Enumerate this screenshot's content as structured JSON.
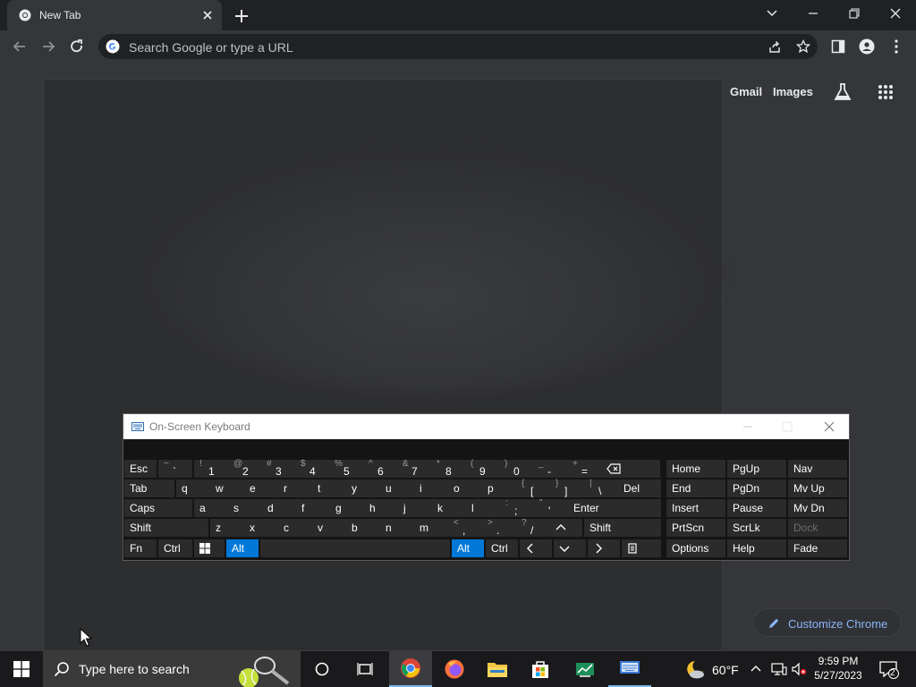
{
  "browser": {
    "tab_title": "New Tab",
    "omnibox_placeholder": "Search Google or type a URL"
  },
  "ntp": {
    "links": [
      "Gmail",
      "Images"
    ],
    "customize_label": "Customize Chrome"
  },
  "osk": {
    "title": "On-Screen Keyboard",
    "rows": [
      [
        {
          "m": "Esc"
        },
        {
          "s": "~",
          "b": "`"
        },
        {
          "s": "!",
          "b": "1"
        },
        {
          "s": "@",
          "b": "2"
        },
        {
          "s": "#",
          "b": "3"
        },
        {
          "s": "$",
          "b": "4"
        },
        {
          "s": "%",
          "b": "5"
        },
        {
          "s": "^",
          "b": "6"
        },
        {
          "s": "&",
          "b": "7"
        },
        {
          "s": "*",
          "b": "8"
        },
        {
          "s": "(",
          "b": "9"
        },
        {
          "s": ")",
          "b": "0"
        },
        {
          "s": "_",
          "b": "-"
        },
        {
          "s": "+",
          "b": "="
        },
        {
          "m": "⌫"
        },
        {
          "m": "Home"
        },
        {
          "m": "PgUp"
        },
        {
          "m": "Nav"
        }
      ],
      [
        {
          "m": "Tab"
        },
        {
          "m": "q"
        },
        {
          "m": "w"
        },
        {
          "m": "e"
        },
        {
          "m": "r"
        },
        {
          "m": "t"
        },
        {
          "m": "y"
        },
        {
          "m": "u"
        },
        {
          "m": "i"
        },
        {
          "m": "o"
        },
        {
          "m": "p"
        },
        {
          "s": "{",
          "b": "["
        },
        {
          "s": "}",
          "b": "]"
        },
        {
          "s": "|",
          "b": "\\"
        },
        {
          "m": "Del"
        },
        {
          "m": "End"
        },
        {
          "m": "PgDn"
        },
        {
          "m": "Mv Up"
        }
      ],
      [
        {
          "m": "Caps"
        },
        {
          "m": "a"
        },
        {
          "m": "s"
        },
        {
          "m": "d"
        },
        {
          "m": "f"
        },
        {
          "m": "g"
        },
        {
          "m": "h"
        },
        {
          "m": "j"
        },
        {
          "m": "k"
        },
        {
          "m": "l"
        },
        {
          "s": ":",
          "b": ";"
        },
        {
          "s": "\"",
          "b": "'"
        },
        {
          "m": "Enter"
        },
        {
          "m": "Insert"
        },
        {
          "m": "Pause"
        },
        {
          "m": "Mv Dn"
        }
      ],
      [
        {
          "m": "Shift"
        },
        {
          "m": "z"
        },
        {
          "m": "x"
        },
        {
          "m": "c"
        },
        {
          "m": "v"
        },
        {
          "m": "b"
        },
        {
          "m": "n"
        },
        {
          "m": "m"
        },
        {
          "s": "<",
          "b": ","
        },
        {
          "s": ">",
          "b": "."
        },
        {
          "s": "?",
          "b": "/"
        },
        {
          "m": "^"
        },
        {
          "m": "Shift"
        },
        {
          "m": "PrtScn"
        },
        {
          "m": "ScrLk"
        },
        {
          "m": "Dock"
        }
      ],
      [
        {
          "m": "Fn"
        },
        {
          "m": "Ctrl"
        },
        {
          "m": "win"
        },
        {
          "m": "Alt"
        },
        {
          "m": ""
        },
        {
          "m": "Alt"
        },
        {
          "m": "Ctrl"
        },
        {
          "m": "<"
        },
        {
          "m": "v"
        },
        {
          "m": ">"
        },
        {
          "m": "menu"
        },
        {
          "m": "Options"
        },
        {
          "m": "Help"
        },
        {
          "m": "Fade"
        }
      ]
    ]
  },
  "taskbar": {
    "search_placeholder": "Type here to search",
    "weather": "60°F",
    "time": "9:59 PM",
    "date": "5/27/2023",
    "notification_count": "2"
  }
}
